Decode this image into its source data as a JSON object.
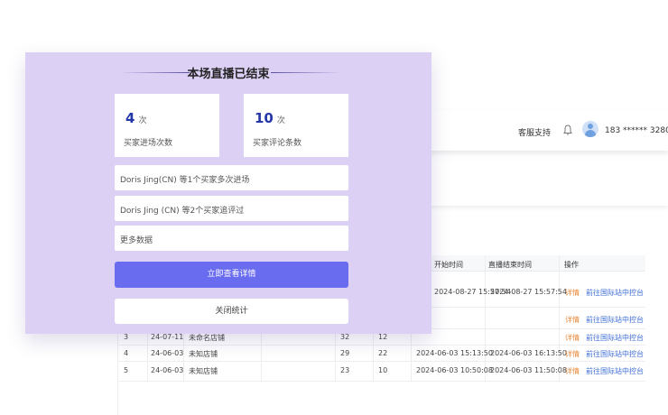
{
  "header": {
    "support_label": "客服支持",
    "user_phone": "183 ****** 3280"
  },
  "table": {
    "headers": {
      "start_time": "开始时间",
      "end_time": "直播结束时间",
      "actions": "操作"
    },
    "rows": [
      {
        "start": "2024-08-27 15:57:54",
        "end": "2024-08-27 15:57:54",
        "detail": "详情",
        "link": "前往国际站中控台"
      },
      {
        "detail": "详情",
        "link": "前往国际站中控台"
      },
      {
        "idx": "3",
        "date": "24-07-11",
        "store": "未命名店铺",
        "a": "32",
        "b": "12",
        "detail": "详情",
        "link": "前往国际站中控台"
      },
      {
        "idx": "4",
        "date": "24-06-03",
        "store": "未知店铺",
        "a": "29",
        "b": "22",
        "start": "2024-06-03 15:13:50",
        "end": "2024-06-03 16:13:50",
        "detail": "详情",
        "link": "前往国际站中控台"
      },
      {
        "idx": "5",
        "date": "24-06-03",
        "store": "未知店铺",
        "a": "23",
        "b": "10",
        "start": "2024-06-03 10:50:08",
        "end": "2024-06-03 11:50:08",
        "detail": "详情",
        "link": "前往国际站中控台"
      }
    ]
  },
  "modal": {
    "title": "本场直播已结束",
    "stats": [
      {
        "value": "4",
        "unit": "次",
        "label": "买家进场次数"
      },
      {
        "value": "10",
        "unit": "次",
        "label": "买家评论条数"
      }
    ],
    "info_rows": [
      "Doris Jing(CN) 等1个买家多次进场",
      "Doris Jing (CN) 等2个买家追评过",
      "更多数据"
    ],
    "primary_button": "立即查看详情",
    "secondary_button": "关闭统计"
  },
  "colors": {
    "modal_bg": "#dcd0f5",
    "primary": "#6a6cf0",
    "stat_number": "#2436a8",
    "link_orange": "#e8883a",
    "link_blue": "#3f6ed6"
  }
}
